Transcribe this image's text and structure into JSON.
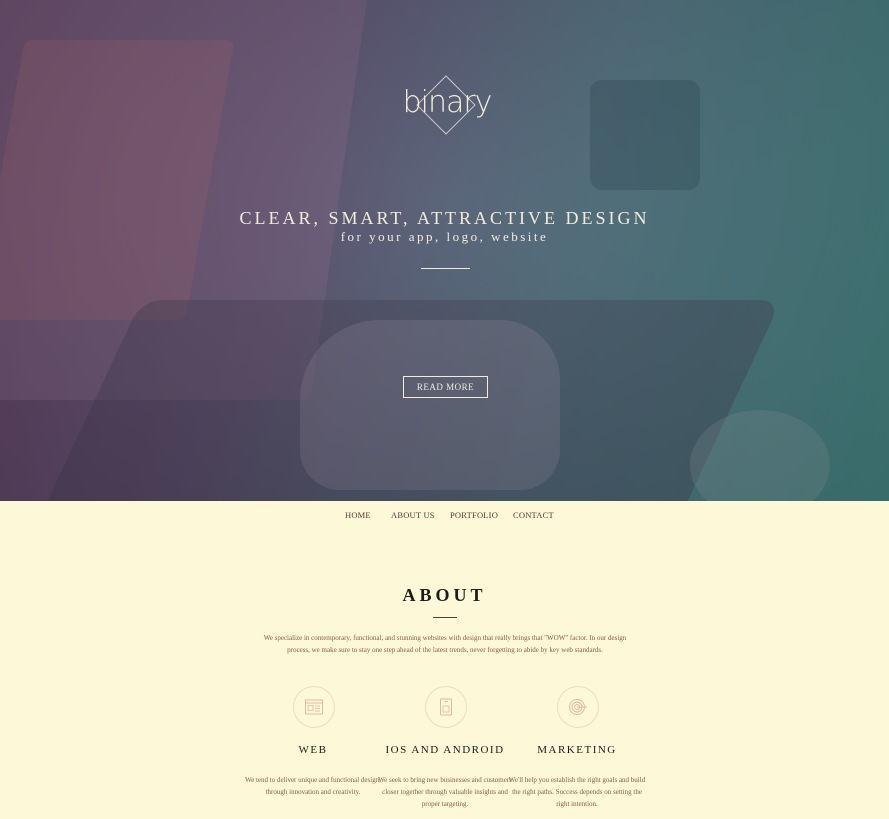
{
  "hero": {
    "logo_text": "binary",
    "tagline": "CLEAR, SMART, ATTRACTIVE DESIGN",
    "subline": "for your app, logo, website",
    "button_label": "READ MORE"
  },
  "nav": {
    "items": [
      {
        "label": "HOME"
      },
      {
        "label": "ABOUT US"
      },
      {
        "label": "PORTFOLIO"
      },
      {
        "label": "CONTACT"
      }
    ]
  },
  "about": {
    "title": "ABOUT",
    "text": "We specialize in contemporary, functional, and stunning websites with design that really brings that \"WOW\" factor. In our design process, we make sure to stay one step ahead of the latest trends, never forgetting to abide by key web standards.",
    "features": [
      {
        "icon": "browser-window-icon",
        "title": "WEB",
        "desc": "We tend to deliver unique and functional design, through innovation and creativity."
      },
      {
        "icon": "mobile-device-icon",
        "title": "IOS AND ANDROID",
        "desc": "We seek to bring new businesses and customers closer together through valuable insights and proper targeting."
      },
      {
        "icon": "target-icon",
        "title": "MARKETING",
        "desc": "We'll help you establish the right goals and build the right paths. Success depends on setting the right intention."
      }
    ]
  },
  "colors": {
    "background": "#fdf8d8",
    "accent": "#8b5a4a",
    "hero_left": "#5b3c5c",
    "hero_right": "#3f7a78"
  }
}
